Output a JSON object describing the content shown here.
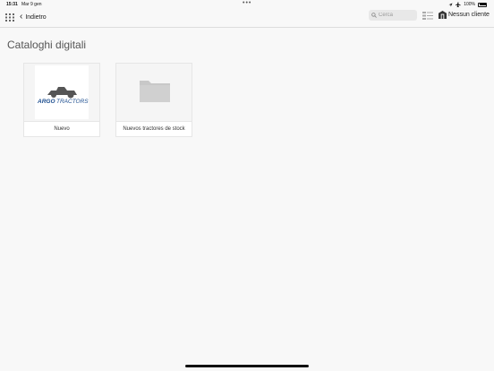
{
  "status_bar": {
    "time": "15:31",
    "date": "Mar 9 gen",
    "battery": "100%",
    "more": "•••"
  },
  "toolbar": {
    "back_label": "Indietro",
    "customer_label": "Nessun cliente"
  },
  "search": {
    "placeholder": "Cerca"
  },
  "page": {
    "title": "Cataloghi digitali"
  },
  "cards": [
    {
      "label": "Nuevo",
      "logo_text_1": "ARGO",
      "logo_text_2": "TRACTORS"
    },
    {
      "label": "Nuevos tractores de stock"
    }
  ],
  "colors": {
    "background": "#f8f8f8",
    "logo_blue": "#1d4e8f",
    "folder": "#c8c8c8"
  }
}
